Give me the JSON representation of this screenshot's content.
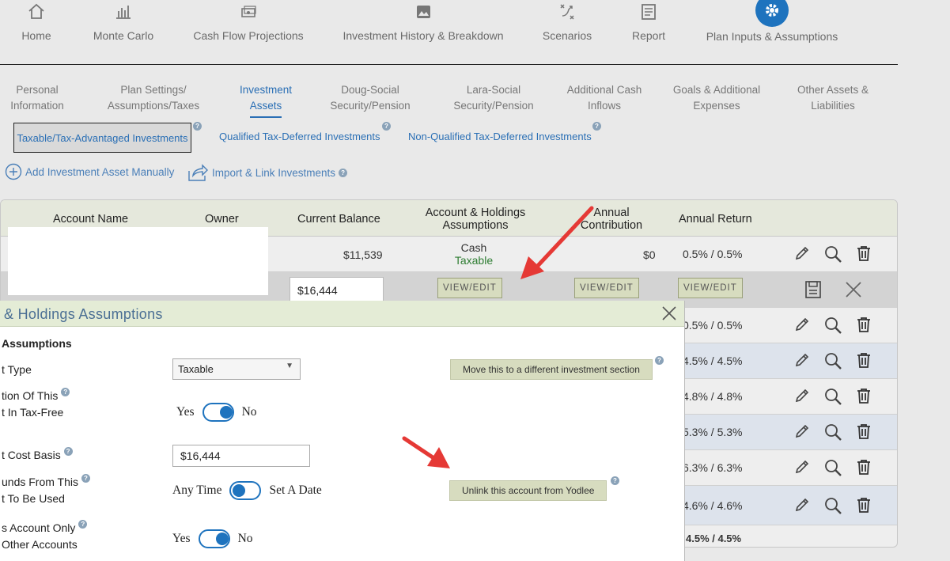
{
  "topnav": {
    "items": [
      {
        "label": "Home",
        "icon": "home-icon"
      },
      {
        "label": "Monte Carlo",
        "icon": "bar-chart-icon"
      },
      {
        "label": "Cash Flow Projections",
        "icon": "cash-icon"
      },
      {
        "label": "Investment History & Breakdown",
        "icon": "image-icon"
      },
      {
        "label": "Scenarios",
        "icon": "strategy-icon"
      },
      {
        "label": "Report",
        "icon": "report-icon"
      },
      {
        "label": "Plan Inputs & Assumptions",
        "icon": "gear-icon"
      }
    ]
  },
  "subtabs": [
    {
      "line1": "Personal",
      "line2": "Information"
    },
    {
      "line1": "Plan Settings/",
      "line2": "Assumptions/Taxes"
    },
    {
      "line1": "Investment",
      "line2": "Assets"
    },
    {
      "line1": "Doug-Social",
      "line2": "Security/Pension"
    },
    {
      "line1": "Lara-Social",
      "line2": "Security/Pension"
    },
    {
      "line1": "Additional Cash",
      "line2": "Inflows"
    },
    {
      "line1": "Goals & Additional",
      "line2": "Expenses"
    },
    {
      "line1": "Other Assets &",
      "line2": "Liabilities"
    }
  ],
  "section_tabs": [
    "Taxable/Tax-Advantaged Investments",
    "Qualified Tax-Deferred Investments",
    "Non-Qualified Tax-Deferred Investments"
  ],
  "actions": {
    "add": "Add Investment Asset Manually",
    "import": "Import & Link Investments"
  },
  "table": {
    "headers": {
      "account_name": "Account Name",
      "owner": "Owner",
      "current_balance": "Current Balance",
      "assumptions": "Account & Holdings\nAssumptions",
      "contribution": "Annual\nContribution",
      "annual_return": "Annual Return"
    },
    "row1": {
      "balance": "$11,539",
      "asset": "Cash",
      "tax": "Taxable",
      "contribution": "$0",
      "return": "0.5% / 0.5%"
    },
    "edit_row": {
      "balance": "$16,444",
      "view_edit": "VIEW/EDIT"
    },
    "returns": [
      "0.5% / 0.5%",
      "4.5% / 4.5%",
      "4.8% / 4.8%",
      "5.3% / 5.3%",
      "6.3% / 6.3%",
      "4.6% / 4.6%"
    ],
    "total_return": "4.5% / 4.5%"
  },
  "modal": {
    "title": "& Holdings Assumptions",
    "section": "Assumptions",
    "type_label": "t Type",
    "type_value": "Taxable",
    "move_button": "Move this to a different investment section",
    "portion_label_1": "tion Of This",
    "portion_label_2": "t In Tax-Free",
    "yes": "Yes",
    "no": "No",
    "cost_basis_label": "t Cost Basis",
    "cost_basis_value": "$16,444",
    "funds_label_1": "unds From This",
    "funds_label_2": "t To Be Used",
    "any_time": "Any Time",
    "set_date": "Set A Date",
    "unlink_button": "Unlink this account from Yodlee",
    "only_label_1": "s Account Only",
    "only_label_2": " Other Accounts"
  },
  "colors": {
    "accent": "#1e73be",
    "link": "#2a6fb5",
    "button_bg": "#d7dcbf",
    "arrow": "#e53935",
    "taxable": "#2e7d32"
  }
}
